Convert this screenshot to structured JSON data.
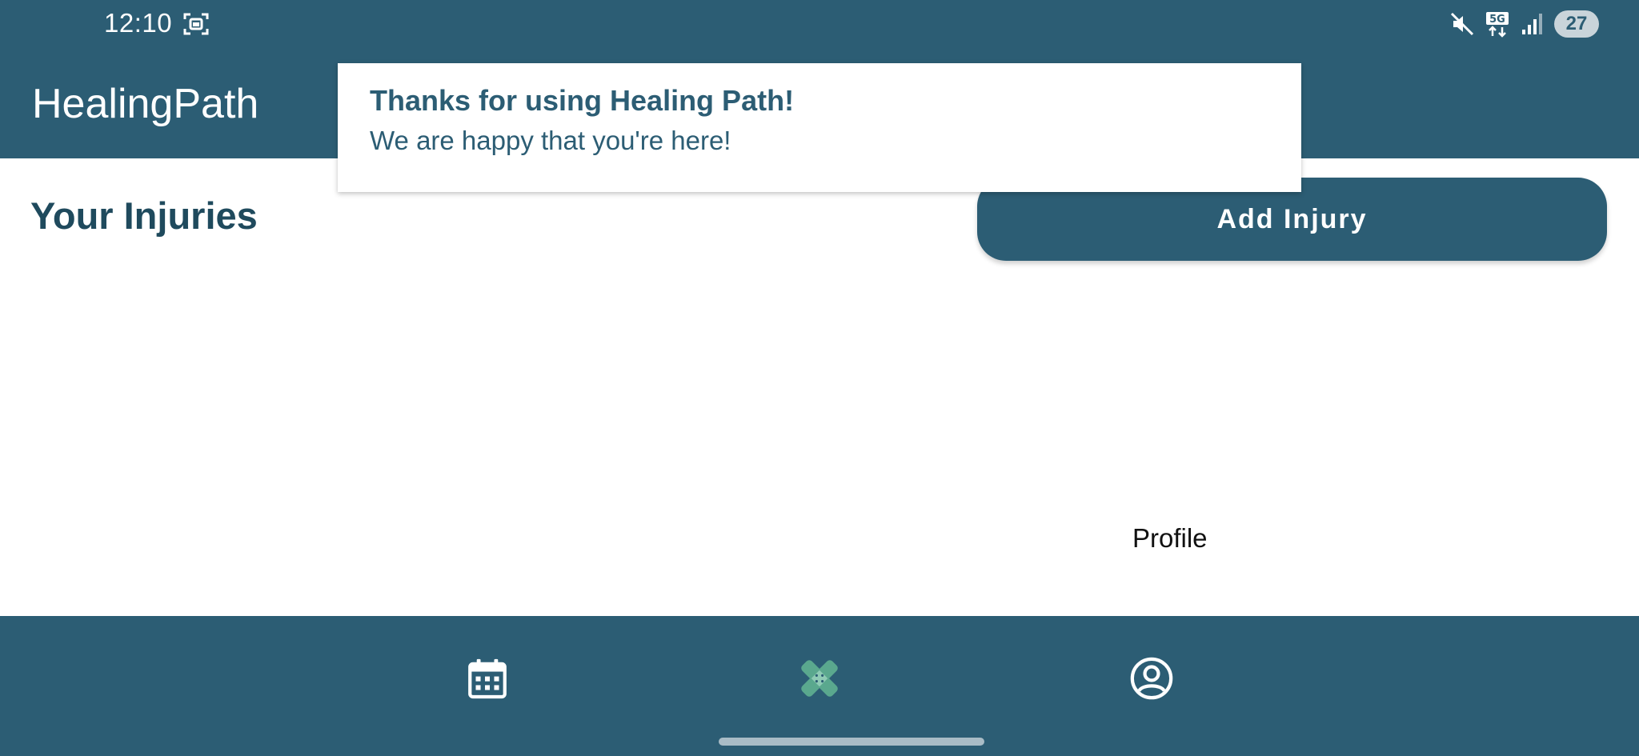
{
  "status_bar": {
    "time": "12:10",
    "battery": "27",
    "icons": [
      "screenshot-icon",
      "mute-icon",
      "5g-icon",
      "signal-icon",
      "battery-icon"
    ]
  },
  "app_bar": {
    "title": "HealingPath"
  },
  "toast": {
    "title": "Thanks for using Healing Path!",
    "message": "We are happy that you're here!"
  },
  "main": {
    "section_title": "Your Injuries",
    "add_button_label": "Add Injury",
    "floating_label": "Profile"
  },
  "bottom_nav": {
    "items": [
      {
        "icon": "calendar-icon",
        "active": false
      },
      {
        "icon": "bandage-icon",
        "active": true
      },
      {
        "icon": "profile-icon",
        "active": false
      }
    ]
  },
  "colors": {
    "primary": "#2c5d74",
    "active_icon": "#5aa88e",
    "text_dark": "#1f4a5d",
    "background": "#ffffff"
  }
}
